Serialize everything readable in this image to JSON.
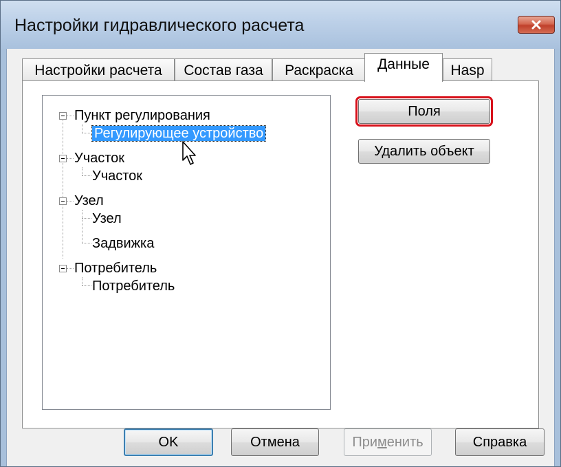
{
  "window": {
    "title": "Настройки гидравлического расчета"
  },
  "tabs": [
    {
      "label": "Настройки расчета"
    },
    {
      "label": "Состав газа"
    },
    {
      "label": "Раскраска"
    },
    {
      "label": "Данные",
      "active": true
    },
    {
      "label": "Hasp"
    }
  ],
  "tree": {
    "groups": [
      {
        "label": "Пункт регулирования",
        "children": [
          "Регулирующее устройство"
        ]
      },
      {
        "label": "Участок",
        "children": [
          "Участок"
        ]
      },
      {
        "label": "Узел",
        "children": [
          "Узел",
          "Задвижка"
        ]
      },
      {
        "label": "Потребитель",
        "children": [
          "Потребитель"
        ]
      }
    ],
    "selected": "Регулирующее устройство"
  },
  "side_buttons": {
    "fields": "Поля",
    "delete_object": "Удалить объект"
  },
  "footer": {
    "ok": "OK",
    "cancel": "Отмена",
    "apply_before": "При",
    "apply_underlined": "м",
    "apply_after": "енить",
    "help": "Справка"
  },
  "colors": {
    "selection": "#3399ff",
    "highlight_outline": "#d7101a",
    "close_button": "#c0402b"
  },
  "icons": {
    "close": "close-icon",
    "cursor": "mouse-pointer-icon"
  }
}
